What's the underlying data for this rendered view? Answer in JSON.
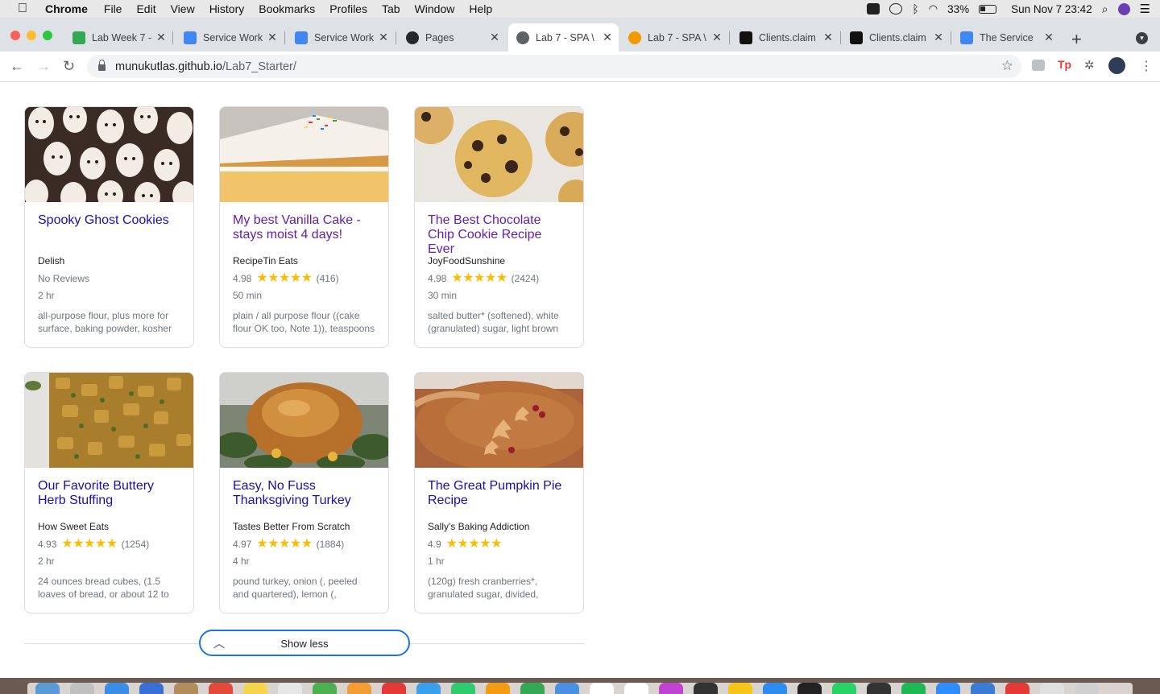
{
  "menubar": {
    "app": "Chrome",
    "items": [
      "File",
      "Edit",
      "View",
      "History",
      "Bookmarks",
      "Profiles",
      "Tab",
      "Window",
      "Help"
    ],
    "battery": "33%",
    "datetime": "Sun Nov 7  23:42"
  },
  "tabs": [
    {
      "title": "Lab Week 7 -",
      "color": "#34a853"
    },
    {
      "title": "Service Work",
      "color": "#4285f4"
    },
    {
      "title": "Service Work",
      "color": "#4285f4"
    },
    {
      "title": "Pages",
      "color": "#24292e"
    },
    {
      "title": "Lab 7 - SPA \\",
      "color": "#5f6368"
    },
    {
      "title": "Lab 7 - SPA \\",
      "color": "#f29900"
    },
    {
      "title": "Clients.claim",
      "color": "#111111"
    },
    {
      "title": "Clients.claim",
      "color": "#111111"
    },
    {
      "title": "The Service",
      "color": "#4285f4"
    }
  ],
  "address": {
    "host": "munukutlas.github.io",
    "path": "/Lab7_Starter/"
  },
  "recipes": [
    {
      "title": "Spooky Ghost Cookies",
      "org": "Delish",
      "score": "",
      "reviews": "No Reviews",
      "stars": "",
      "time": "2 hr",
      "ingredients": "all-purpose flour, plus more for surface, baking powder, kosher",
      "visited": false
    },
    {
      "title": "My best Vanilla Cake - stays moist 4 days!",
      "org": "RecipeTin Eats",
      "score": "4.98",
      "reviews": "(416)",
      "stars": "★★★★★",
      "time": "50 min",
      "ingredients": "plain / all purpose flour ((cake flour OK too, Note 1)), teaspoons",
      "visited": true
    },
    {
      "title": "The Best Chocolate Chip Cookie Recipe Ever",
      "org": "JoyFoodSunshine",
      "score": "4.98",
      "reviews": "(2424)",
      "stars": "★★★★★",
      "time": "30 min",
      "ingredients": "salted butter* (softened), white (granulated) sugar, light brown",
      "visited": true
    },
    {
      "title": "Our Favorite Buttery Herb Stuffing",
      "org": "How Sweet Eats",
      "score": "4.93",
      "reviews": "(1254)",
      "stars": "★★★★★",
      "time": "2 hr",
      "ingredients": "24 ounces bread cubes, (1.5 loaves of bread, or about 12 to",
      "visited": false
    },
    {
      "title": "Easy, No Fuss Thanksgiving Turkey",
      "org": "Tastes Better From Scratch",
      "score": "4.97",
      "reviews": "(1884)",
      "stars": "★★★★★",
      "time": "4 hr",
      "ingredients": "pound turkey, onion (, peeled and quartered), lemon (, quartered),",
      "visited": false
    },
    {
      "title": "The Great Pumpkin Pie Recipe",
      "org": "Sally's Baking Addiction",
      "score": "4.9",
      "reviews": "",
      "stars": "★★★★★",
      "time": "1 hr",
      "ingredients": "(120g) fresh cranberries*, granulated sugar, divided,",
      "visited": false
    }
  ],
  "show_less_label": "Show less"
}
